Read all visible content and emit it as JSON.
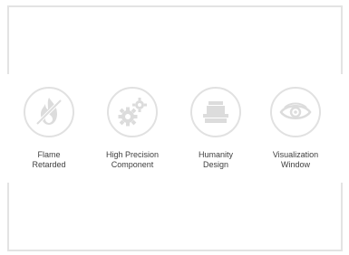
{
  "features": [
    {
      "label": "Flame\nRetarded",
      "icon": "flame-retardant-icon"
    },
    {
      "label": "High Precision\nComponent",
      "icon": "gears-icon"
    },
    {
      "label": "Humanity\nDesign",
      "icon": "device-icon"
    },
    {
      "label": "Visualization\nWindow",
      "icon": "eye-icon"
    }
  ],
  "colors": {
    "icon_fill": "#dcdcdc",
    "circle_border": "#e1e1e1",
    "text": "#404040",
    "frame_border": "#e3e3e3"
  }
}
